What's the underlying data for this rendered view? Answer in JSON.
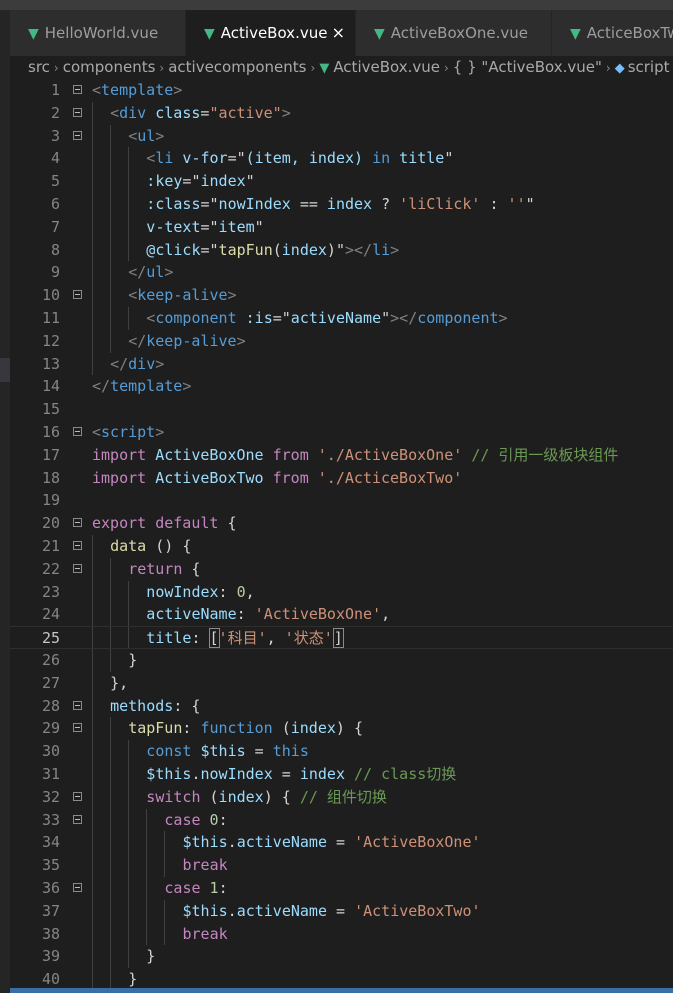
{
  "tabs": [
    {
      "label": "HelloWorld.vue",
      "active": false
    },
    {
      "label": "ActiveBox.vue",
      "active": true
    },
    {
      "label": "ActiveBoxOne.vue",
      "active": false
    },
    {
      "label": "ActiceBoxTwo",
      "active": false
    }
  ],
  "tab_close": "×",
  "breadcrumb": [
    "src",
    "components",
    "activecomponents",
    "ActiveBox.vue",
    "{ } \"ActiveBox.vue\"",
    "script"
  ],
  "colors": {
    "editor_bg": "#1e1e1e",
    "tag": "#569cd6",
    "attr": "#9cdcfe",
    "string": "#ce9178",
    "keyword": "#c586c0",
    "class": "#4ec9b0",
    "comment": "#6a9955",
    "vue_green": "#42b883"
  },
  "current_line": 25,
  "lines": [
    {
      "n": "1",
      "fold": true,
      "indent": 0,
      "tokens": [
        [
          "t-punc",
          "<"
        ],
        [
          "t-tag",
          "template"
        ],
        [
          "t-punc",
          ">"
        ]
      ]
    },
    {
      "n": "2",
      "fold": true,
      "indent": 1,
      "tokens": [
        [
          "t-punc",
          "<"
        ],
        [
          "t-tag",
          "div"
        ],
        [
          "t-def",
          " "
        ],
        [
          "t-attr",
          "class"
        ],
        [
          "t-def",
          "="
        ],
        [
          "t-str",
          "\"active\""
        ],
        [
          "t-punc",
          ">"
        ]
      ]
    },
    {
      "n": "3",
      "fold": true,
      "indent": 2,
      "tokens": [
        [
          "t-punc",
          "<"
        ],
        [
          "t-tag",
          "ul"
        ],
        [
          "t-punc",
          ">"
        ]
      ]
    },
    {
      "n": "4",
      "fold": false,
      "indent": 3,
      "tokens": [
        [
          "t-punc",
          "<"
        ],
        [
          "t-tag",
          "li"
        ],
        [
          "t-def",
          " "
        ],
        [
          "t-attr",
          "v-for"
        ],
        [
          "t-def",
          "=\""
        ],
        [
          "t-attr",
          "(item, index)"
        ],
        [
          "t-def",
          " "
        ],
        [
          "t-kw2",
          "in"
        ],
        [
          "t-def",
          " "
        ],
        [
          "t-attr",
          "title"
        ],
        [
          "t-def",
          "\""
        ]
      ]
    },
    {
      "n": "5",
      "fold": false,
      "indent": 3,
      "tokens": [
        [
          "t-attr",
          ":key"
        ],
        [
          "t-def",
          "=\""
        ],
        [
          "t-attr",
          "index"
        ],
        [
          "t-def",
          "\""
        ]
      ]
    },
    {
      "n": "6",
      "fold": false,
      "indent": 3,
      "tokens": [
        [
          "t-attr",
          ":class"
        ],
        [
          "t-def",
          "=\""
        ],
        [
          "t-attr",
          "nowIndex"
        ],
        [
          "t-def",
          " == "
        ],
        [
          "t-attr",
          "index"
        ],
        [
          "t-def",
          " ? "
        ],
        [
          "t-str",
          "'liClick'"
        ],
        [
          "t-def",
          " : "
        ],
        [
          "t-str",
          "''"
        ],
        [
          "t-def",
          "\""
        ]
      ]
    },
    {
      "n": "7",
      "fold": false,
      "indent": 3,
      "tokens": [
        [
          "t-attr",
          "v-text"
        ],
        [
          "t-def",
          "=\""
        ],
        [
          "t-attr",
          "item"
        ],
        [
          "t-def",
          "\""
        ]
      ]
    },
    {
      "n": "8",
      "fold": false,
      "indent": 3,
      "tokens": [
        [
          "t-attr",
          "@click"
        ],
        [
          "t-def",
          "=\""
        ],
        [
          "t-fn",
          "tapFun"
        ],
        [
          "t-def",
          "("
        ],
        [
          "t-attr",
          "index"
        ],
        [
          "t-def",
          ")\""
        ],
        [
          "t-punc",
          "></"
        ],
        [
          "t-tag",
          "li"
        ],
        [
          "t-punc",
          ">"
        ]
      ]
    },
    {
      "n": "9",
      "fold": false,
      "indent": 2,
      "tokens": [
        [
          "t-punc",
          "</"
        ],
        [
          "t-tag",
          "ul"
        ],
        [
          "t-punc",
          ">"
        ]
      ]
    },
    {
      "n": "10",
      "fold": true,
      "indent": 2,
      "tokens": [
        [
          "t-punc",
          "<"
        ],
        [
          "t-tag",
          "keep-alive"
        ],
        [
          "t-punc",
          ">"
        ]
      ]
    },
    {
      "n": "11",
      "fold": false,
      "indent": 3,
      "tokens": [
        [
          "t-punc",
          "<"
        ],
        [
          "t-tag",
          "component"
        ],
        [
          "t-def",
          " "
        ],
        [
          "t-attr",
          ":is"
        ],
        [
          "t-def",
          "=\""
        ],
        [
          "t-attr",
          "activeName"
        ],
        [
          "t-def",
          "\""
        ],
        [
          "t-punc",
          "></"
        ],
        [
          "t-tag",
          "component"
        ],
        [
          "t-punc",
          ">"
        ]
      ]
    },
    {
      "n": "12",
      "fold": false,
      "indent": 2,
      "tokens": [
        [
          "t-punc",
          "</"
        ],
        [
          "t-tag",
          "keep-alive"
        ],
        [
          "t-punc",
          ">"
        ]
      ]
    },
    {
      "n": "13",
      "fold": false,
      "indent": 1,
      "tokens": [
        [
          "t-punc",
          "</"
        ],
        [
          "t-tag",
          "div"
        ],
        [
          "t-punc",
          ">"
        ]
      ]
    },
    {
      "n": "14",
      "fold": false,
      "indent": 0,
      "tokens": [
        [
          "t-punc",
          "</"
        ],
        [
          "t-tag",
          "template"
        ],
        [
          "t-punc",
          ">"
        ]
      ]
    },
    {
      "n": "15",
      "fold": false,
      "indent": 0,
      "tokens": []
    },
    {
      "n": "16",
      "fold": true,
      "indent": 0,
      "tokens": [
        [
          "t-punc",
          "<"
        ],
        [
          "t-tag",
          "script"
        ],
        [
          "t-punc",
          ">"
        ]
      ]
    },
    {
      "n": "17",
      "fold": false,
      "indent": 0,
      "tokens": [
        [
          "t-kw",
          "import"
        ],
        [
          "t-def",
          " "
        ],
        [
          "t-var",
          "ActiveBoxOne"
        ],
        [
          "t-def",
          " "
        ],
        [
          "t-kw",
          "from"
        ],
        [
          "t-def",
          " "
        ],
        [
          "t-str",
          "'./ActiveBoxOne'"
        ],
        [
          "t-def",
          " "
        ],
        [
          "t-com",
          "// 引用一级板块组件"
        ]
      ]
    },
    {
      "n": "18",
      "fold": false,
      "indent": 0,
      "tokens": [
        [
          "t-kw",
          "import"
        ],
        [
          "t-def",
          " "
        ],
        [
          "t-var",
          "ActiveBoxTwo"
        ],
        [
          "t-def",
          " "
        ],
        [
          "t-kw",
          "from"
        ],
        [
          "t-def",
          " "
        ],
        [
          "t-str",
          "'./ActiceBoxTwo'"
        ]
      ]
    },
    {
      "n": "19",
      "fold": false,
      "indent": 0,
      "tokens": []
    },
    {
      "n": "20",
      "fold": true,
      "indent": 0,
      "tokens": [
        [
          "t-kw",
          "export"
        ],
        [
          "t-def",
          " "
        ],
        [
          "t-kw",
          "default"
        ],
        [
          "t-def",
          " {"
        ]
      ]
    },
    {
      "n": "21",
      "fold": true,
      "indent": 1,
      "tokens": [
        [
          "t-fn",
          "data"
        ],
        [
          "t-def",
          " () {"
        ]
      ]
    },
    {
      "n": "22",
      "fold": true,
      "indent": 2,
      "tokens": [
        [
          "t-kw",
          "return"
        ],
        [
          "t-def",
          " {"
        ]
      ]
    },
    {
      "n": "23",
      "fold": false,
      "indent": 3,
      "tokens": [
        [
          "t-var",
          "nowIndex"
        ],
        [
          "t-def",
          ": "
        ],
        [
          "t-num",
          "0"
        ],
        [
          "t-def",
          ","
        ]
      ]
    },
    {
      "n": "24",
      "fold": false,
      "indent": 3,
      "tokens": [
        [
          "t-var",
          "activeName"
        ],
        [
          "t-def",
          ": "
        ],
        [
          "t-str",
          "'ActiveBoxOne'"
        ],
        [
          "t-def",
          ","
        ]
      ]
    },
    {
      "n": "25",
      "fold": false,
      "indent": 3,
      "tokens": [
        [
          "t-var",
          "title"
        ],
        [
          "t-def",
          ": "
        ],
        [
          "bracket",
          "["
        ],
        [
          "t-str",
          "'科目'"
        ],
        [
          "t-def",
          ", "
        ],
        [
          "t-str",
          "'状态'"
        ],
        [
          "cursor",
          ""
        ],
        [
          "bracket",
          "]"
        ]
      ]
    },
    {
      "n": "26",
      "fold": false,
      "indent": 2,
      "tokens": [
        [
          "t-def",
          "}"
        ]
      ]
    },
    {
      "n": "27",
      "fold": false,
      "indent": 1,
      "tokens": [
        [
          "t-def",
          "},"
        ]
      ]
    },
    {
      "n": "28",
      "fold": true,
      "indent": 1,
      "tokens": [
        [
          "t-var",
          "methods"
        ],
        [
          "t-def",
          ": {"
        ]
      ]
    },
    {
      "n": "29",
      "fold": true,
      "indent": 2,
      "tokens": [
        [
          "t-fn",
          "tapFun"
        ],
        [
          "t-def",
          ": "
        ],
        [
          "t-kw2",
          "function"
        ],
        [
          "t-def",
          " ("
        ],
        [
          "t-var",
          "index"
        ],
        [
          "t-def",
          ") {"
        ]
      ]
    },
    {
      "n": "30",
      "fold": false,
      "indent": 3,
      "tokens": [
        [
          "t-kw2",
          "const"
        ],
        [
          "t-def",
          " "
        ],
        [
          "t-var",
          "$this"
        ],
        [
          "t-def",
          " = "
        ],
        [
          "t-kw2",
          "this"
        ]
      ]
    },
    {
      "n": "31",
      "fold": false,
      "indent": 3,
      "tokens": [
        [
          "t-var",
          "$this"
        ],
        [
          "t-def",
          "."
        ],
        [
          "t-var",
          "nowIndex"
        ],
        [
          "t-def",
          " = "
        ],
        [
          "t-var",
          "index"
        ],
        [
          "t-def",
          " "
        ],
        [
          "t-com",
          "// class切换"
        ]
      ]
    },
    {
      "n": "32",
      "fold": true,
      "indent": 3,
      "tokens": [
        [
          "t-kw",
          "switch"
        ],
        [
          "t-def",
          " ("
        ],
        [
          "t-var",
          "index"
        ],
        [
          "t-def",
          ") { "
        ],
        [
          "t-com",
          "// 组件切换"
        ]
      ]
    },
    {
      "n": "33",
      "fold": true,
      "indent": 4,
      "tokens": [
        [
          "t-kw",
          "case"
        ],
        [
          "t-def",
          " "
        ],
        [
          "t-num",
          "0"
        ],
        [
          "t-def",
          ":"
        ]
      ]
    },
    {
      "n": "34",
      "fold": false,
      "indent": 5,
      "tokens": [
        [
          "t-var",
          "$this"
        ],
        [
          "t-def",
          "."
        ],
        [
          "t-var",
          "activeName"
        ],
        [
          "t-def",
          " = "
        ],
        [
          "t-str",
          "'ActiveBoxOne'"
        ]
      ]
    },
    {
      "n": "35",
      "fold": false,
      "indent": 5,
      "tokens": [
        [
          "t-kw",
          "break"
        ]
      ]
    },
    {
      "n": "36",
      "fold": true,
      "indent": 4,
      "tokens": [
        [
          "t-kw",
          "case"
        ],
        [
          "t-def",
          " "
        ],
        [
          "t-num",
          "1"
        ],
        [
          "t-def",
          ":"
        ]
      ]
    },
    {
      "n": "37",
      "fold": false,
      "indent": 5,
      "tokens": [
        [
          "t-var",
          "$this"
        ],
        [
          "t-def",
          "."
        ],
        [
          "t-var",
          "activeName"
        ],
        [
          "t-def",
          " = "
        ],
        [
          "t-str",
          "'ActiveBoxTwo'"
        ]
      ]
    },
    {
      "n": "38",
      "fold": false,
      "indent": 5,
      "tokens": [
        [
          "t-kw",
          "break"
        ]
      ]
    },
    {
      "n": "39",
      "fold": false,
      "indent": 3,
      "tokens": [
        [
          "t-def",
          "}"
        ]
      ]
    },
    {
      "n": "40",
      "fold": false,
      "indent": 2,
      "tokens": [
        [
          "t-def",
          "}"
        ]
      ]
    }
  ]
}
